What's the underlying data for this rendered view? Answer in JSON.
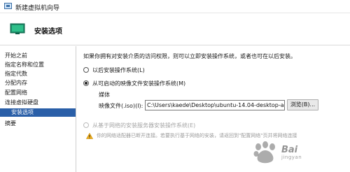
{
  "window": {
    "title": "新建虚拟机向导"
  },
  "header": {
    "title": "安装选项"
  },
  "sidebar": {
    "items": [
      {
        "label": "开始之前"
      },
      {
        "label": "指定名称和位置"
      },
      {
        "label": "指定代数"
      },
      {
        "label": "分配内存"
      },
      {
        "label": "配置网络"
      },
      {
        "label": "连接虚拟硬盘"
      },
      {
        "label": "安装选项"
      },
      {
        "label": "摘要"
      }
    ],
    "active_index": 6
  },
  "main": {
    "intro": "如果你拥有对安装介质的访问权限，则可以立即安装操作系统，或者也可在以后安装。",
    "option_later": "以后安装操作系统(L)",
    "option_image": "从可启动的映像文件安装操作系统(M)",
    "media_group": "媒体",
    "image_file_label": "映像文件(.iso)(I):",
    "image_file_value": "C:\\Users\\kaede\\Desktop\\ubuntu-14.04-desktop-a",
    "browse_label": "浏览(B)...",
    "option_network": "从基于网络的安装服务器安装操作系统(E)",
    "network_warning": "你的网络适配器已断开连接。若要执行基于网络的安装，请返回到\"配置网络\"页并将网络连接",
    "selected_option": "image"
  },
  "watermark": {
    "text": "Bai",
    "sub": "jingyan"
  },
  "colors": {
    "accent": "#2a5fa8",
    "disabled_text": "#a5a5a5",
    "warning": "#e8a317"
  }
}
